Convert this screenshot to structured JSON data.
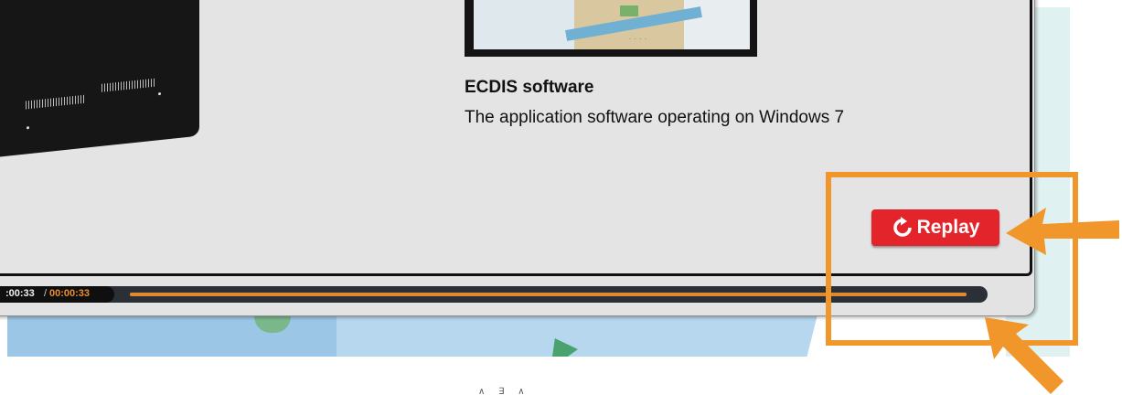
{
  "content": {
    "title": "ECDIS software",
    "subtitle": "The application software operating on Windows 7"
  },
  "replay_button": {
    "label": "Replay",
    "icon": "refresh-icon",
    "color": "#e3242b"
  },
  "player": {
    "current_time": ":00:33",
    "separator": "/",
    "total_time": "00:00:33",
    "progress": 1.0,
    "accent_color": "#ee8d2b"
  },
  "annotation": {
    "highlight_color": "#f0962a"
  },
  "caption": "∧ ∃ ∧"
}
